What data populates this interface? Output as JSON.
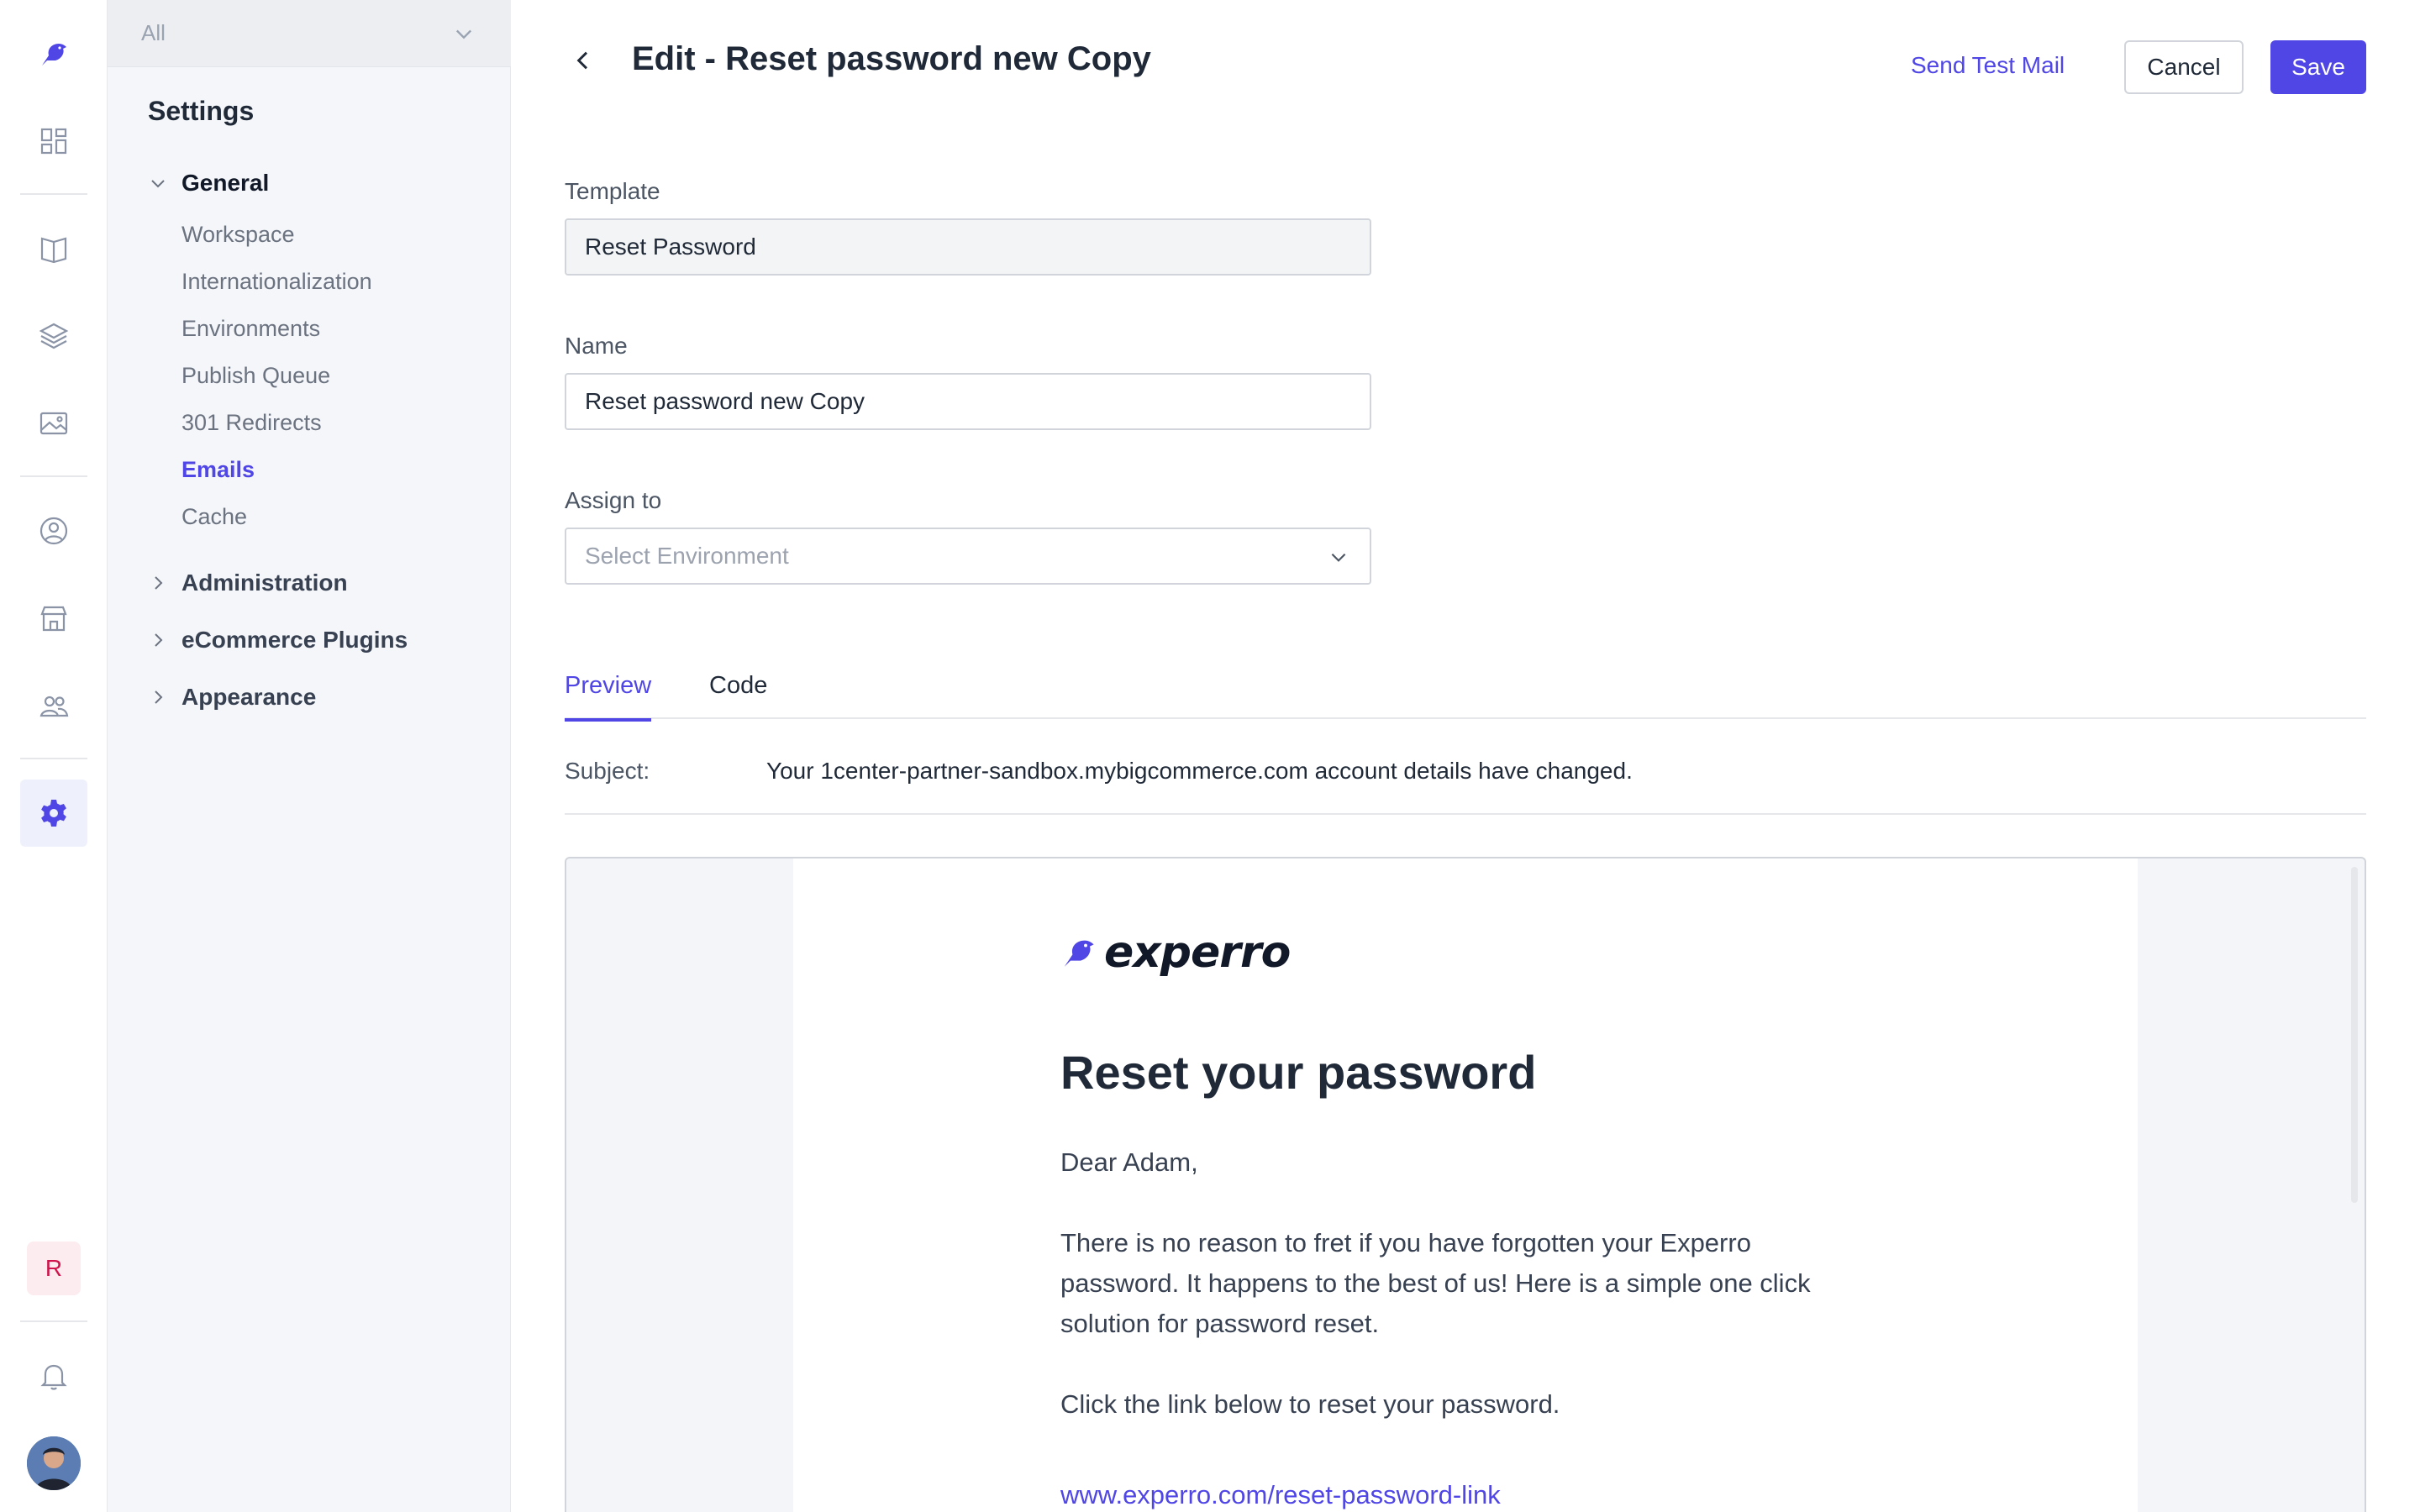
{
  "rail": {
    "items": [
      {
        "icon": "dashboard-icon"
      },
      {
        "icon": "book-icon"
      },
      {
        "icon": "layers-icon"
      },
      {
        "icon": "image-icon"
      },
      {
        "icon": "user-circle-icon"
      },
      {
        "icon": "store-icon"
      },
      {
        "icon": "users-icon"
      },
      {
        "icon": "settings-gear-icon"
      }
    ],
    "user_initial": "R"
  },
  "sidebar": {
    "environment": "All",
    "title": "Settings",
    "groups": {
      "general": "General",
      "administration": "Administration",
      "ecommerce": "eCommerce Plugins",
      "appearance": "Appearance"
    },
    "general_items": [
      "Workspace",
      "Internationalization",
      "Environments",
      "Publish Queue",
      "301 Redirects",
      "Emails",
      "Cache"
    ],
    "active_item": "Emails"
  },
  "header": {
    "title": "Edit - Reset password new Copy",
    "send_test_label": "Send Test Mail",
    "cancel_label": "Cancel",
    "save_label": "Save"
  },
  "form": {
    "template_label": "Template",
    "template_value": "Reset Password",
    "name_label": "Name",
    "name_value": "Reset password new Copy",
    "assign_label": "Assign to",
    "assign_placeholder": "Select Environment"
  },
  "tabs": {
    "preview": "Preview",
    "code": "Code",
    "active": "Preview"
  },
  "subject": {
    "label": "Subject:",
    "value": "Your 1center-partner-sandbox.mybigcommerce.com account details have changed."
  },
  "email_preview": {
    "logo_text": "experro",
    "heading": "Reset your password",
    "greeting": "Dear Adam,",
    "paragraph": "There is no reason to fret if you have forgotten your Experro password. It happens to the best of us! Here is a simple one click solution for password reset.",
    "instruction": "Click the link below to reset your password.",
    "link": "www.experro.com/reset-password-link"
  },
  "colors": {
    "accent": "#4f46e5",
    "sidebar_bg": "#f4f6f9",
    "user_badge": "#d1134b"
  }
}
